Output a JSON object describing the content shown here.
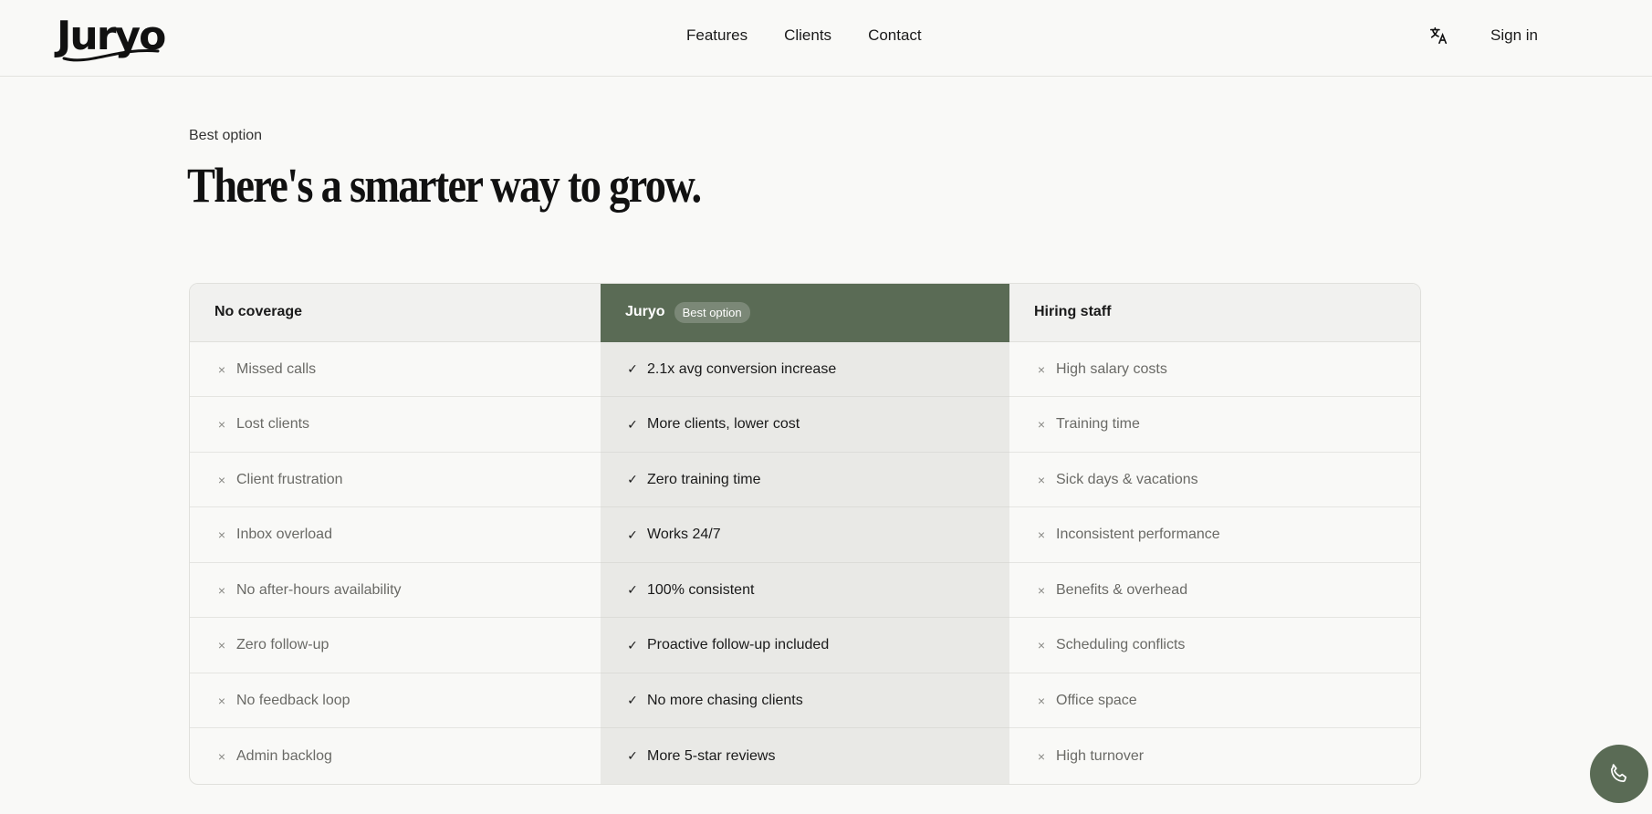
{
  "brand": {
    "name": "Juryo"
  },
  "nav": {
    "links": [
      "Features",
      "Clients",
      "Contact"
    ],
    "signin_label": "Sign in",
    "translate_icon": "translate-icon"
  },
  "hero": {
    "eyebrow": "Best option",
    "headline": "There's a smarter way to grow."
  },
  "comparison": {
    "columns": [
      {
        "title": "No coverage",
        "mark": "×",
        "items": [
          "Missed calls",
          "Lost clients",
          "Client frustration",
          "Inbox overload",
          "No after-hours availability",
          "Zero follow-up",
          "No feedback loop",
          "Admin backlog"
        ]
      },
      {
        "title": "Juryo",
        "badge": "Best option",
        "mark": "✓",
        "items": [
          "2.1x avg conversion increase",
          "More clients, lower cost",
          "Zero training time",
          "Works 24/7",
          "100% consistent",
          "Proactive follow-up included",
          "No more chasing clients",
          "More 5-star reviews"
        ]
      },
      {
        "title": "Hiring staff",
        "mark": "×",
        "items": [
          "High salary costs",
          "Training time",
          "Sick days & vacations",
          "Inconsistent performance",
          "Benefits & overhead",
          "Scheduling conflicts",
          "Office space",
          "High turnover"
        ]
      }
    ]
  },
  "call_button": {
    "icon": "phone-icon"
  },
  "colors": {
    "accent": "#5a6b55",
    "background": "#f9f9f7"
  }
}
